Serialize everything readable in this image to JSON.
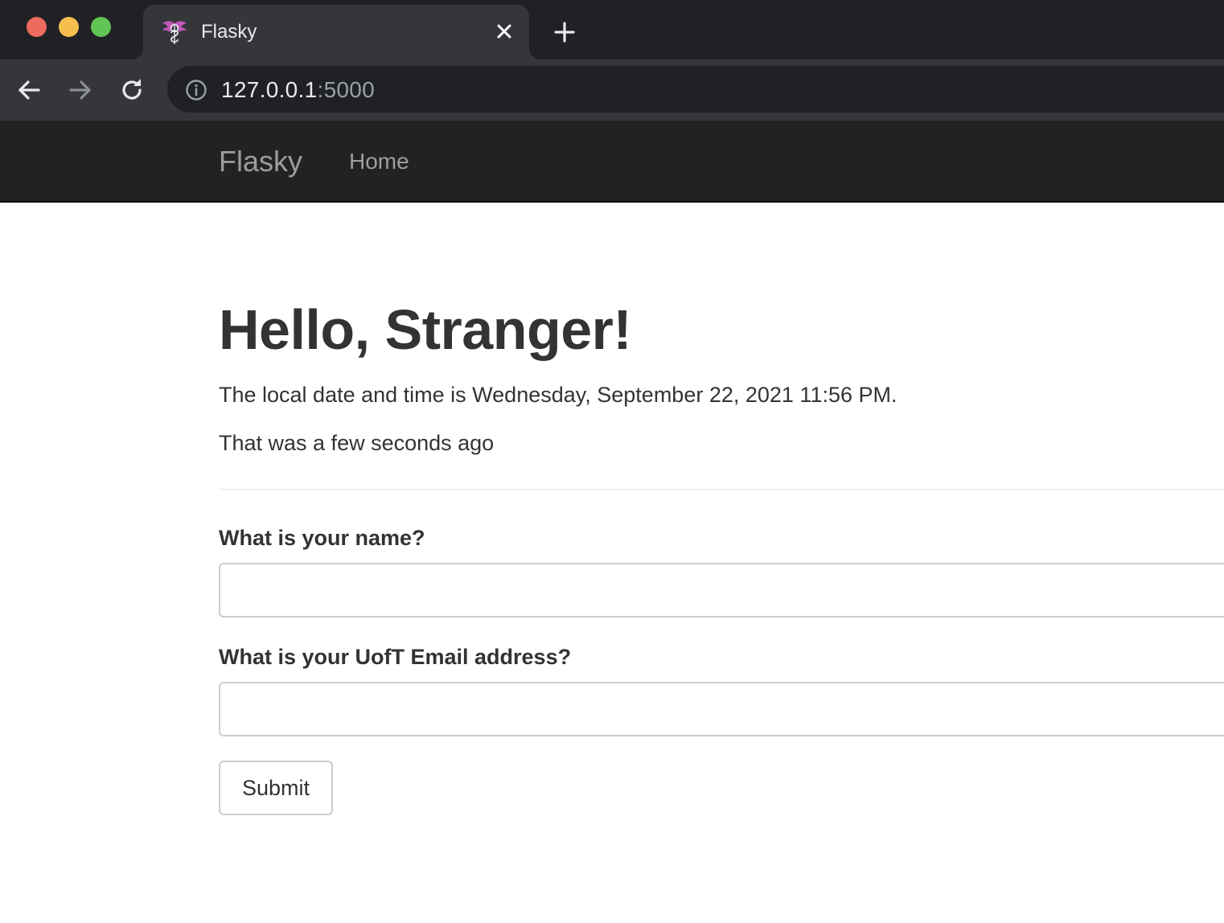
{
  "browser": {
    "tab": {
      "title": "Flasky",
      "favicon": "flask-winged-logo-icon"
    },
    "toolbar": {
      "back_icon": "arrow-left-icon",
      "forward_icon": "arrow-right-icon",
      "reload_icon": "reload-icon",
      "info_icon": "info-icon",
      "url_host": "127.0.0.1",
      "url_port": ":5000"
    },
    "colors": {
      "tabbar": "#202124",
      "tab_active": "#35363a",
      "omnibox": "#202124"
    }
  },
  "navbar": {
    "brand": "Flasky",
    "links": [
      {
        "label": "Home"
      }
    ],
    "background": "#222222",
    "link_color": "#9d9d9d"
  },
  "main": {
    "greeting": "Hello, Stranger!",
    "datetime_text": "The local date and time is Wednesday, September 22, 2021 11:56 PM.",
    "relative_text": "That was a few seconds ago",
    "form": {
      "name_label": "What is your name?",
      "name_value": "",
      "email_label": "What is your UofT Email address?",
      "email_value": "",
      "submit_label": "Submit"
    }
  }
}
